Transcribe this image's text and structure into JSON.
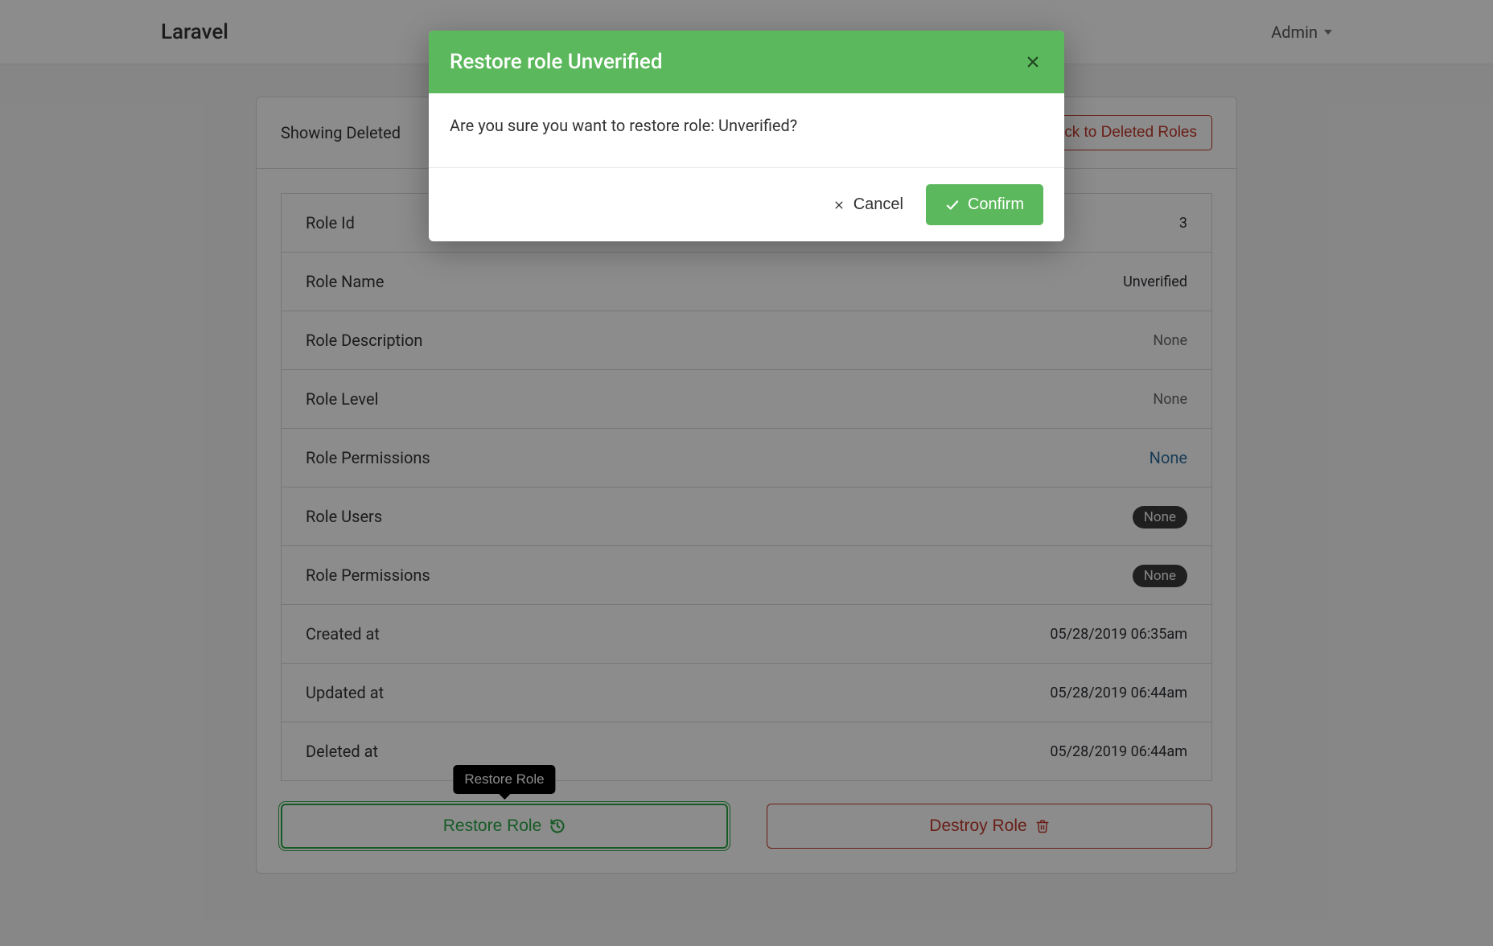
{
  "navbar": {
    "brand": "Laravel",
    "user": "Admin"
  },
  "header": {
    "title": "Showing Deleted",
    "back_button": "Back to Deleted Roles"
  },
  "role": {
    "fields": [
      {
        "label": "Role Id",
        "value": "3",
        "type": "text"
      },
      {
        "label": "Role Name",
        "value": "Unverified",
        "type": "text"
      },
      {
        "label": "Role Description",
        "value": "None",
        "type": "muted"
      },
      {
        "label": "Role Level",
        "value": "None",
        "type": "muted"
      },
      {
        "label": "Role Permissions",
        "value": "None",
        "type": "link"
      },
      {
        "label": "Role Users",
        "value": "None",
        "type": "badge"
      },
      {
        "label": "Role Permissions",
        "value": "None",
        "type": "badge"
      },
      {
        "label": "Created at",
        "value": "05/28/2019 06:35am",
        "type": "text"
      },
      {
        "label": "Updated at",
        "value": "05/28/2019 06:44am",
        "type": "text"
      },
      {
        "label": "Deleted at",
        "value": "05/28/2019 06:44am",
        "type": "text"
      }
    ]
  },
  "actions": {
    "restore": "Restore Role",
    "destroy": "Destroy Role",
    "tooltip": "Restore Role"
  },
  "modal": {
    "title": "Restore role Unverified",
    "body": "Are you sure you want to restore role: Unverified?",
    "cancel": "Cancel",
    "confirm": "Confirm"
  }
}
